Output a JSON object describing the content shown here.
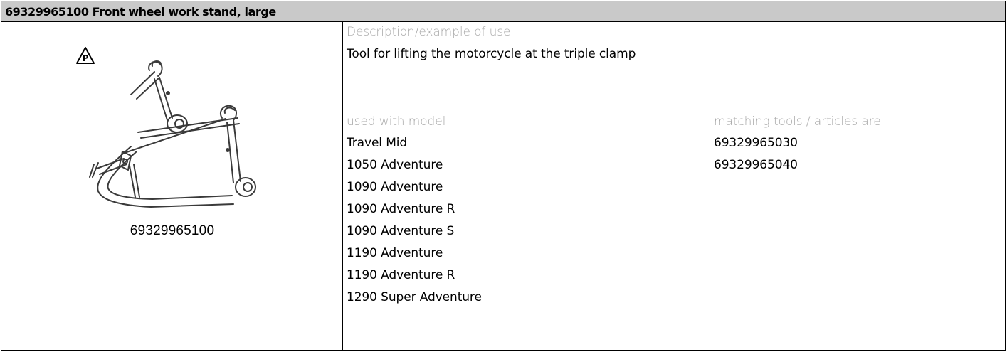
{
  "header": {
    "title": "69329965100 Front wheel work stand, large"
  },
  "illustration": {
    "icon": "p-warning-triangle-icon",
    "part_number": "69329965100"
  },
  "description": {
    "label": "Description/example of use",
    "text": "Tool for lifting the motorcycle at the triple clamp"
  },
  "models": {
    "label": "used with model",
    "items": [
      "Travel Mid",
      "1050 Adventure",
      "1090 Adventure",
      "1090 Adventure R",
      "1090 Adventure S",
      "1190 Adventure",
      "1190 Adventure R",
      "1290 Super Adventure"
    ]
  },
  "matching": {
    "label": "matching tools / articles are",
    "items": [
      "69329965030",
      "69329965040"
    ]
  },
  "colors": {
    "header_bg": "#c9c9c9",
    "muted_text": "#a8a8a8",
    "border": "#000000"
  }
}
